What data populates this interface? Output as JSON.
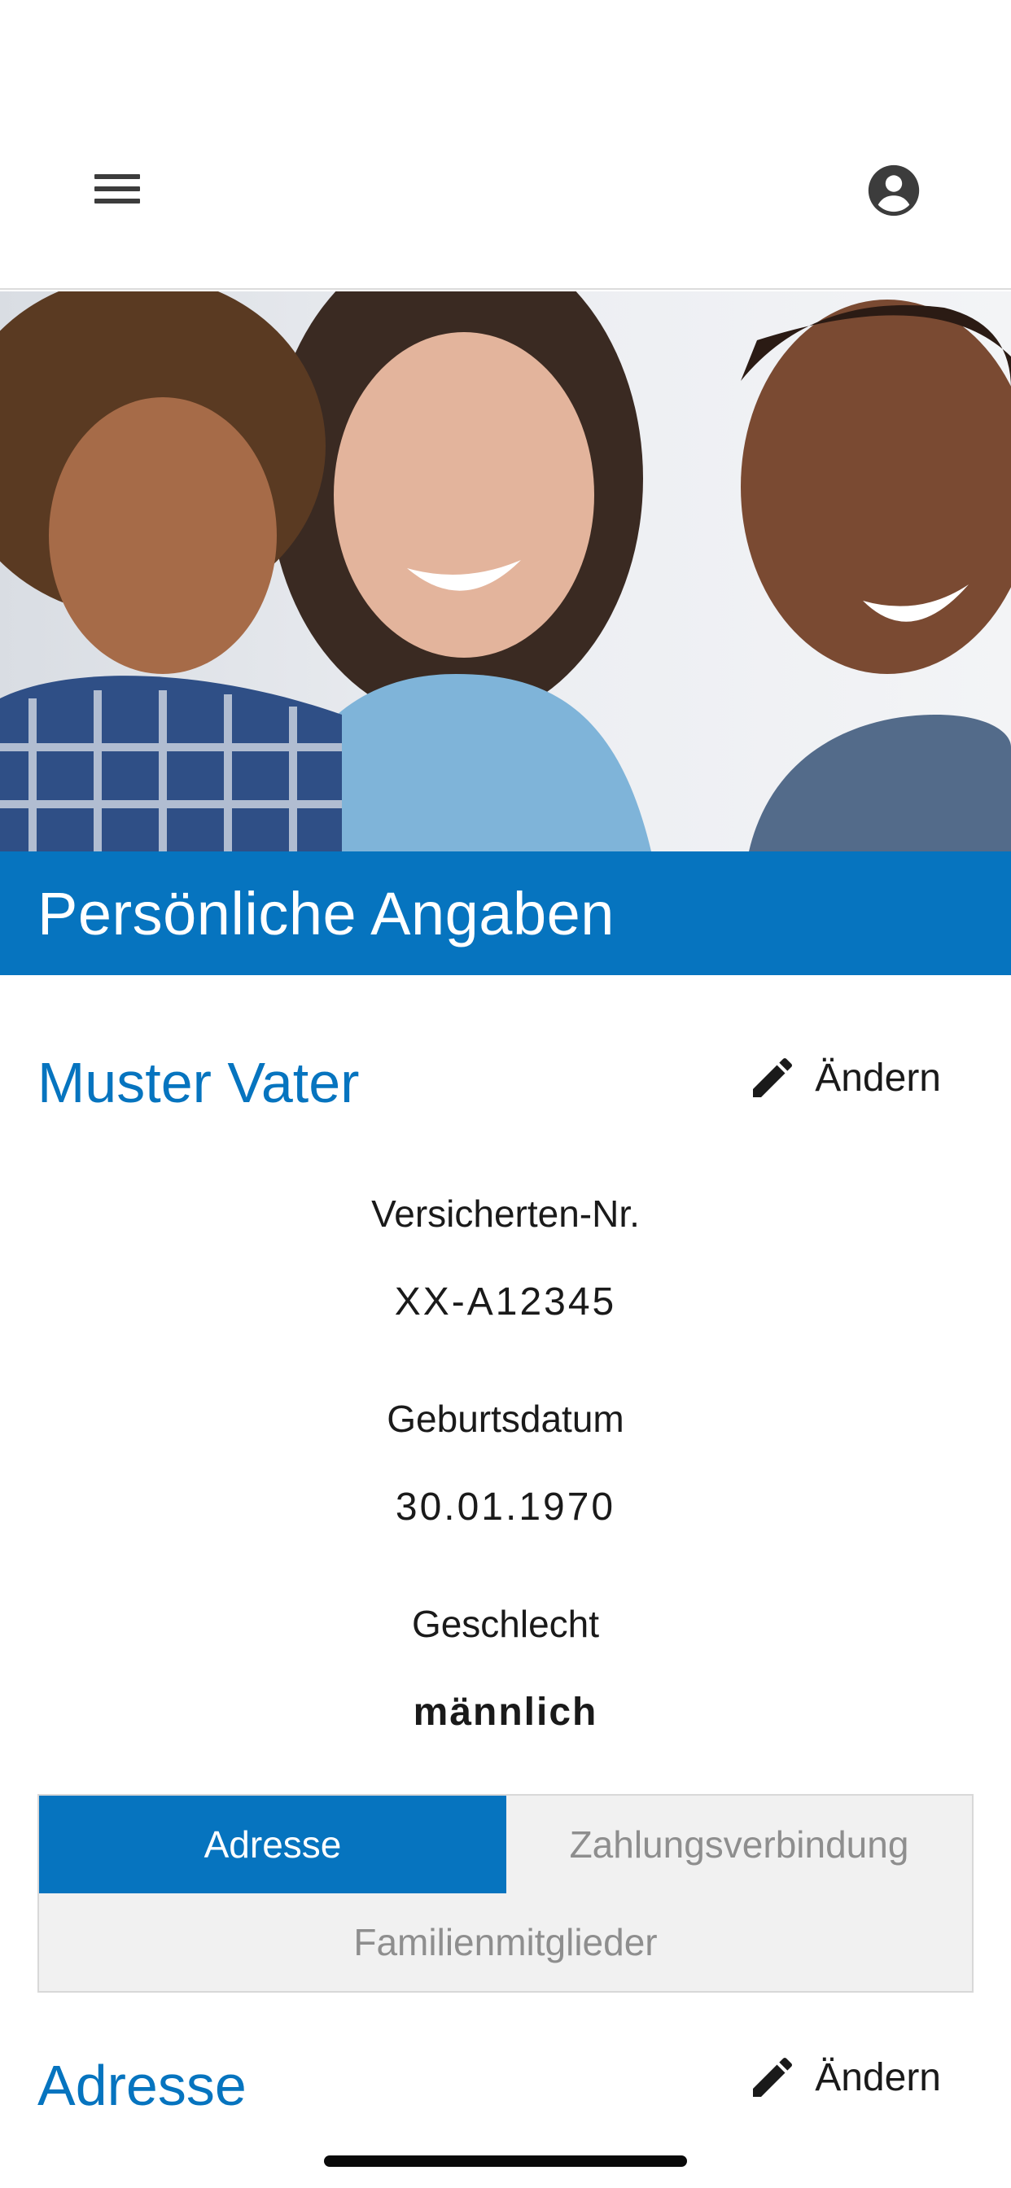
{
  "header": {
    "menu_icon": "hamburger-menu-icon",
    "account_icon": "account-circle-icon"
  },
  "hero": {
    "image": "family-photo"
  },
  "page": {
    "title": "Persönliche Angaben"
  },
  "person": {
    "name": "Muster Vater",
    "edit_label": "Ändern",
    "fields": [
      {
        "label": "Versicherten-Nr.",
        "value": "XX-A12345"
      },
      {
        "label": "Geburtsdatum",
        "value": "30.01.1970"
      },
      {
        "label": "Geschlecht",
        "value": "männlich"
      }
    ]
  },
  "tabs": [
    {
      "label": "Adresse",
      "active": true
    },
    {
      "label": "Zahlungsverbindung",
      "active": false
    },
    {
      "label": "Familienmitglieder",
      "active": false
    }
  ],
  "address_section": {
    "title": "Adresse",
    "edit_label": "Ändern"
  },
  "colors": {
    "primary": "#0674bf",
    "tab_inactive_bg": "#f1f1f1",
    "tab_inactive_text": "#8e8e8e"
  }
}
